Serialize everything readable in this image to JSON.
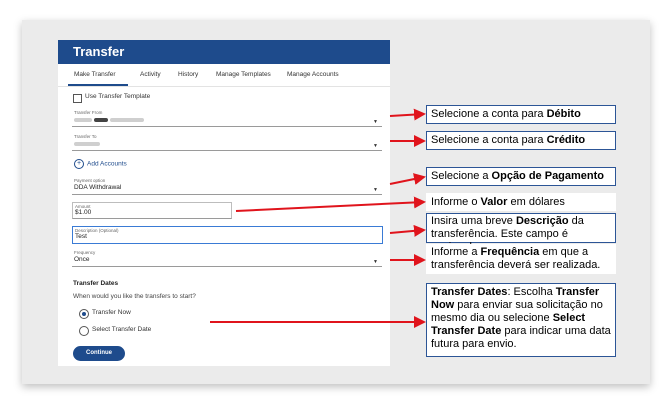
{
  "header": {
    "title": "Transfer"
  },
  "tabs": [
    "Make Transfer",
    "Activity",
    "History",
    "Manage Templates",
    "Manage Accounts"
  ],
  "template": {
    "label": "Use Transfer Template"
  },
  "transfer_from": {
    "label": "Transfer From"
  },
  "transfer_to": {
    "label": "Transfer To"
  },
  "add_accounts": {
    "label": "Add Accounts"
  },
  "payment_option": {
    "label": "Payment option",
    "value": "DDA Withdrawal"
  },
  "amount": {
    "label": "Amount",
    "value": "$1.00"
  },
  "description": {
    "label": "Description (Optional)",
    "value": "Test"
  },
  "frequency": {
    "label": "Frequency",
    "value": "Once"
  },
  "dates": {
    "title": "Transfer Dates",
    "question": "When would you like the transfers to start?",
    "options": [
      "Transfer Now",
      "Select Transfer Date"
    ],
    "selected": "Transfer Now"
  },
  "continue_label": "Continue",
  "callouts": {
    "debito": {
      "pre": "Selecione a conta para ",
      "bold": "Débito"
    },
    "credito": {
      "pre": "Selecione a conta para ",
      "bold": "Crédito"
    },
    "pagamento": {
      "pre": "Selecione a ",
      "bold": "Opção de Pagamento"
    },
    "valor": {
      "pre": "Informe o ",
      "bold": "Valor",
      "post": " em dólares"
    },
    "descricao": {
      "pre": "Insira uma breve ",
      "bold": "Descrição",
      "post": " da transferência. Este campo é opcional."
    },
    "frequencia": {
      "pre": "Informe a ",
      "bold": "Frequência",
      "post": " em que a transferência deverá ser realizada."
    },
    "datas": {
      "b1": "Transfer Dates",
      "t1": ": Escolha ",
      "b2": "Transfer Now",
      "t2": " para enviar sua solicitação no mesmo dia ou selecione ",
      "b3": "Select Transfer Date",
      "t3": " para indicar uma data futura para envio."
    }
  },
  "colors": {
    "brand": "#1e4b8c",
    "arrow": "#e0141c",
    "callout_border": "#2c5596",
    "focus": "#3a7bd5"
  }
}
